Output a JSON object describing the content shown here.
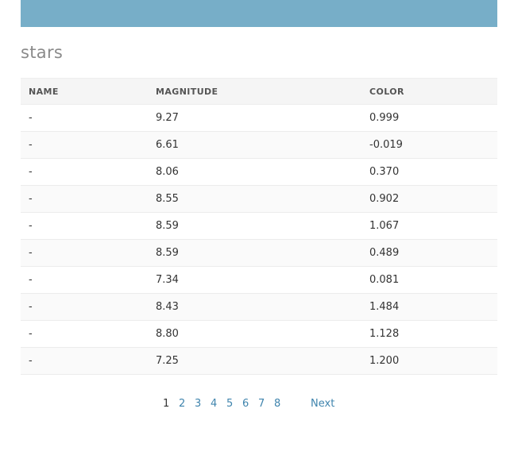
{
  "page": {
    "title": "stars"
  },
  "table": {
    "headers": {
      "name": "NAME",
      "magnitude": "MAGNITUDE",
      "color": "COLOR"
    },
    "rows": [
      {
        "name": "-",
        "magnitude": "9.27",
        "color": "0.999"
      },
      {
        "name": "-",
        "magnitude": "6.61",
        "color": "-0.019"
      },
      {
        "name": "-",
        "magnitude": "8.06",
        "color": "0.370"
      },
      {
        "name": "-",
        "magnitude": "8.55",
        "color": "0.902"
      },
      {
        "name": "-",
        "magnitude": "8.59",
        "color": "1.067"
      },
      {
        "name": "-",
        "magnitude": "8.59",
        "color": "0.489"
      },
      {
        "name": "-",
        "magnitude": "7.34",
        "color": "0.081"
      },
      {
        "name": "-",
        "magnitude": "8.43",
        "color": "1.484"
      },
      {
        "name": "-",
        "magnitude": "8.80",
        "color": "1.128"
      },
      {
        "name": "-",
        "magnitude": "7.25",
        "color": "1.200"
      }
    ]
  },
  "pagination": {
    "pages": [
      "1",
      "2",
      "3",
      "4",
      "5",
      "6",
      "7",
      "8"
    ],
    "current": "1",
    "next_label": "Next"
  },
  "colors": {
    "header_bar": "#77aec8",
    "link": "#3f84ad",
    "title": "#8a8a8a"
  }
}
